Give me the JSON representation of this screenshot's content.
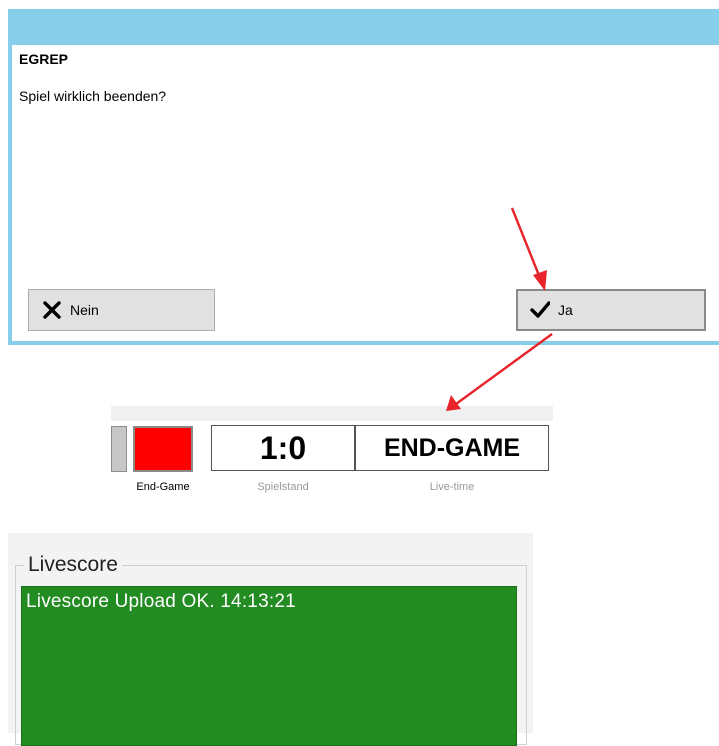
{
  "dialog": {
    "title": "EGREP",
    "message": "Spiel wirklich beenden?",
    "no_label": "Nein",
    "yes_label": "Ja"
  },
  "scoreboard": {
    "score": "1:0",
    "live_time": "END-GAME",
    "end_game_caption": "End-Game",
    "score_caption": "Spielstand",
    "live_caption": "Live-time"
  },
  "livescore": {
    "legend": "Livescore",
    "status": "Livescore Upload OK. 14:13:21"
  },
  "colors": {
    "dialog_frame": "#87ceeb",
    "end_game_indicator": "#ff0000",
    "livescore_panel": "#228b22",
    "arrow": "#e8232a"
  },
  "icons": {
    "no": "x-icon",
    "yes": "checkmark-icon"
  }
}
